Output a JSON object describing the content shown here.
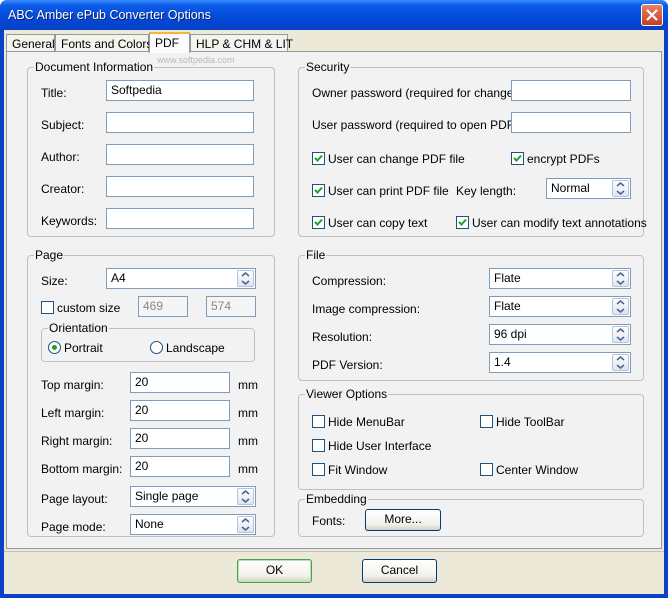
{
  "window": {
    "title": "ABC Amber ePub Converter Options"
  },
  "tabs": [
    {
      "label": "General"
    },
    {
      "label": "Fonts and Colors"
    },
    {
      "label": "PDF"
    },
    {
      "label": "HLP & CHM & LIT"
    }
  ],
  "active_tab": "PDF",
  "watermark": "www.softpedia.com",
  "document_info": {
    "title": "Document Information",
    "title_label": "Title:",
    "title_value": "Softpedia",
    "subject_label": "Subject:",
    "subject_value": "",
    "author_label": "Author:",
    "author_value": "",
    "creator_label": "Creator:",
    "creator_value": "",
    "keywords_label": "Keywords:",
    "keywords_value": ""
  },
  "security": {
    "title": "Security",
    "owner_label": "Owner password (required for changes):",
    "owner_value": "",
    "user_label": "User password (required to open PDF):",
    "user_value": "",
    "change_pdf": {
      "label": "User can change PDF file",
      "checked": true
    },
    "encrypt": {
      "label": "encrypt PDFs",
      "checked": true
    },
    "print_pdf": {
      "label": "User can print PDF file",
      "checked": true
    },
    "key_length_label": "Key length:",
    "key_length_value": "Normal",
    "copy_text": {
      "label": "User can copy text",
      "checked": true
    },
    "modify_annotations": {
      "label": "User can modify text annotations",
      "checked": true
    }
  },
  "page": {
    "title": "Page",
    "size_label": "Size:",
    "size_value": "A4",
    "custom_size": {
      "label": "custom size",
      "checked": false
    },
    "custom_width": "469",
    "custom_height": "574",
    "orientation": {
      "title": "Orientation",
      "portrait": "Portrait",
      "landscape": "Landscape",
      "selected": "Portrait"
    },
    "top_margin_label": "Top margin:",
    "top_margin_value": "20",
    "left_margin_label": "Left margin:",
    "left_margin_value": "20",
    "right_margin_label": "Right margin:",
    "right_margin_value": "20",
    "bottom_margin_label": "Bottom margin:",
    "bottom_margin_value": "20",
    "unit": "mm",
    "layout_label": "Page layout:",
    "layout_value": "Single page",
    "mode_label": "Page mode:",
    "mode_value": "None"
  },
  "file": {
    "title": "File",
    "compression_label": "Compression:",
    "compression_value": "Flate",
    "image_compression_label": "Image compression:",
    "image_compression_value": "Flate",
    "resolution_label": "Resolution:",
    "resolution_value": "96 dpi",
    "pdf_version_label": "PDF Version:",
    "pdf_version_value": "1.4"
  },
  "viewer": {
    "title": "Viewer Options",
    "hide_menubar": {
      "label": "Hide MenuBar",
      "checked": false
    },
    "hide_toolbar": {
      "label": "Hide ToolBar",
      "checked": false
    },
    "hide_ui": {
      "label": "Hide User Interface",
      "checked": false
    },
    "fit_window": {
      "label": "Fit Window",
      "checked": false
    },
    "center_window": {
      "label": "Center Window",
      "checked": false
    }
  },
  "embedding": {
    "title": "Embedding",
    "fonts_label": "Fonts:",
    "more_button": "More..."
  },
  "footer": {
    "ok": "OK",
    "cancel": "Cancel"
  },
  "colors": {
    "title_bar": "#0a5ce8",
    "dialog_bg": "#ece9d8",
    "panel_bg": "#f2f2f2",
    "active_tab_accent": "#f9b43c"
  }
}
